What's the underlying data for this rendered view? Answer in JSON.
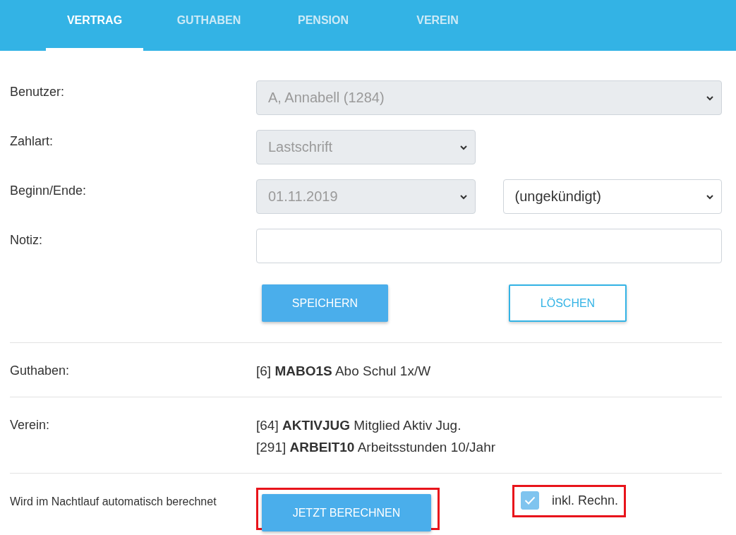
{
  "tabs": [
    {
      "label": "VERTRAG",
      "selected": true
    },
    {
      "label": "GUTHABEN",
      "selected": false
    },
    {
      "label": "PENSION",
      "selected": false
    },
    {
      "label": "VEREIN",
      "selected": false
    }
  ],
  "form": {
    "fields": [
      {
        "label": "Benutzer:",
        "controls": [
          {
            "kind": "wideselect",
            "value": "A, Annabell (1284)",
            "disabled": true
          }
        ]
      },
      {
        "label": "Zahlart:",
        "controls": [
          {
            "kind": "select",
            "value": "Lastschrift",
            "disabled": true
          }
        ]
      },
      {
        "label": "Beginn/Ende:",
        "controls": [
          {
            "kind": "select",
            "value": "01.11.2019",
            "disabled": true
          },
          {
            "kind": "select",
            "value": "(ungekündigt)",
            "disabled": false
          }
        ]
      },
      {
        "label": "Notiz:",
        "controls": [
          {
            "kind": "text"
          }
        ]
      }
    ],
    "buttons": [
      {
        "label": "SPEICHERN",
        "kind": "primary"
      },
      {
        "label": "LÖSCHEN",
        "kind": "outline"
      }
    ]
  },
  "info": [
    {
      "label": "Guthaben:",
      "lines": [
        "[6] **MABO1S** Abo Schul 1x/W"
      ]
    },
    {
      "label": "Verein:",
      "lines": [
        "[64] **AKTIVJUG** Mitglied Aktiv Jug.",
        "[291] **ARBEIT10** Arbeitsstunden 10/Jahr"
      ]
    }
  ],
  "calculation": {
    "note": "Wird im Nachtlauf automatisch berechnet",
    "button": {
      "label": "JETZT BERECHNEN",
      "highlighted": true
    },
    "option": {
      "label": "inkl. Rechn.",
      "checked": true,
      "highlighted": true
    }
  }
}
